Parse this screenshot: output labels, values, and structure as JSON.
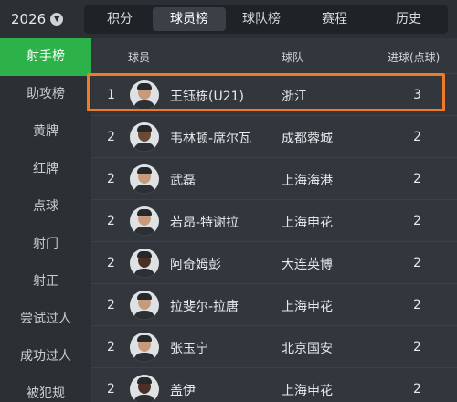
{
  "header": {
    "season": "2026",
    "tabs": [
      {
        "label": "积分",
        "active": false
      },
      {
        "label": "球员榜",
        "active": true
      },
      {
        "label": "球队榜",
        "active": false
      },
      {
        "label": "赛程",
        "active": false
      },
      {
        "label": "历史",
        "active": false
      }
    ]
  },
  "sidebar": {
    "items": [
      {
        "label": "射手榜",
        "active": true
      },
      {
        "label": "助攻榜",
        "active": false
      },
      {
        "label": "黄牌",
        "active": false
      },
      {
        "label": "红牌",
        "active": false
      },
      {
        "label": "点球",
        "active": false
      },
      {
        "label": "射门",
        "active": false
      },
      {
        "label": "射正",
        "active": false
      },
      {
        "label": "尝试过人",
        "active": false
      },
      {
        "label": "成功过人",
        "active": false
      },
      {
        "label": "被犯规",
        "active": false
      }
    ]
  },
  "table": {
    "columns": {
      "player": "球员",
      "team": "球队",
      "goals": "进球(点球)"
    },
    "rows": [
      {
        "rank": "1",
        "player": "王钰栋(U21)",
        "team": "浙江",
        "goals": "3"
      },
      {
        "rank": "2",
        "player": "韦林顿-席尔瓦",
        "team": "成都蓉城",
        "goals": "2"
      },
      {
        "rank": "2",
        "player": "武磊",
        "team": "上海海港",
        "goals": "2"
      },
      {
        "rank": "2",
        "player": "若昂-特谢拉",
        "team": "上海申花",
        "goals": "2"
      },
      {
        "rank": "2",
        "player": "阿奇姆彭",
        "team": "大连英博",
        "goals": "2"
      },
      {
        "rank": "2",
        "player": "拉斐尔-拉唐",
        "team": "上海申花",
        "goals": "2"
      },
      {
        "rank": "2",
        "player": "张玉宁",
        "team": "北京国安",
        "goals": "2"
      },
      {
        "rank": "2",
        "player": "盖伊",
        "team": "上海申花",
        "goals": "2"
      }
    ]
  },
  "colors": {
    "accent": "#2db24a",
    "highlight_border": "#f07b24",
    "background": "#2b3035"
  }
}
